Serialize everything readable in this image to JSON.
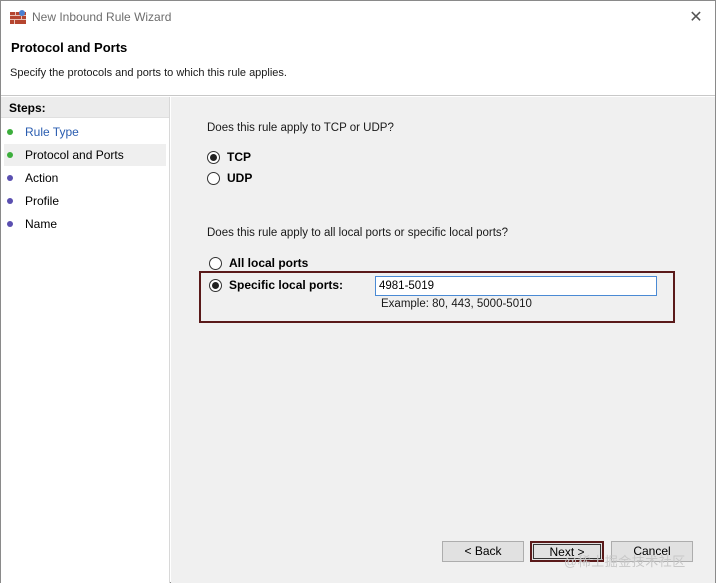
{
  "window": {
    "title": "New Inbound Rule Wizard",
    "close_glyph": "✕"
  },
  "header": {
    "title": "Protocol and Ports",
    "subtitle": "Specify the protocols and ports to which this rule applies."
  },
  "steps": {
    "heading": "Steps:",
    "items": [
      {
        "label": "Rule Type",
        "state": "completed",
        "dot_color": "#3cae3c"
      },
      {
        "label": "Protocol and Ports",
        "state": "current",
        "dot_color": "#3cae3c"
      },
      {
        "label": "Action",
        "state": "pending",
        "dot_color": "#5a4fb0"
      },
      {
        "label": "Profile",
        "state": "pending",
        "dot_color": "#5a4fb0"
      },
      {
        "label": "Name",
        "state": "pending",
        "dot_color": "#5a4fb0"
      }
    ]
  },
  "protocol": {
    "question": "Does this rule apply to TCP or UDP?",
    "options": [
      {
        "label": "TCP",
        "checked": true
      },
      {
        "label": "UDP",
        "checked": false
      }
    ]
  },
  "ports": {
    "question": "Does this rule apply to all local ports or specific local ports?",
    "all_label": "All local ports",
    "all_checked": false,
    "specific_label": "Specific local ports:",
    "specific_checked": true,
    "value": "4981-5019",
    "example": "Example: 80, 443, 5000-5010"
  },
  "buttons": {
    "back": "< Back",
    "next": "Next >",
    "cancel": "Cancel"
  },
  "watermark": "@稀土掘金技术社区",
  "colors": {
    "highlight_border": "#5a1a1a",
    "content_bg": "#f0f0f0",
    "link": "#2a5db0"
  }
}
